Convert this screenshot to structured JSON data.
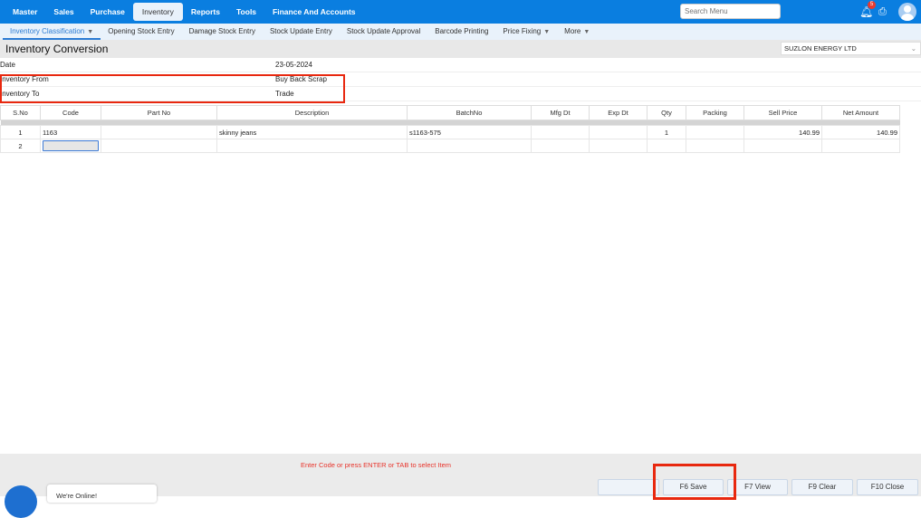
{
  "topnav": {
    "items": [
      "Master",
      "Sales",
      "Purchase",
      "Inventory",
      "Reports",
      "Tools",
      "Finance And Accounts"
    ],
    "active": "Inventory"
  },
  "search": {
    "placeholder": "Search Menu"
  },
  "notifications": {
    "count": "5"
  },
  "subnav": {
    "items": [
      "Inventory Classification",
      "Opening Stock Entry",
      "Damage Stock Entry",
      "Stock Update Entry",
      "Stock Update Approval",
      "Barcode Printing",
      "Price Fixing",
      "More"
    ]
  },
  "page": {
    "title": "Inventory Conversion",
    "company": "SUZLON ENERGY LTD"
  },
  "form": {
    "date_label": "Date",
    "date": "23-05-2024",
    "from_label": "Inventory From",
    "from": "Buy Back Scrap",
    "to_label": "Inventory To",
    "to": "Trade"
  },
  "table": {
    "headers": [
      "S.No",
      "Code",
      "Part No",
      "Description",
      "BatchNo",
      "Mfg Dt",
      "Exp Dt",
      "Qty",
      "Packing",
      "Sell Price",
      "Net Amount"
    ],
    "rows": [
      {
        "sno": "1",
        "code": "1163",
        "part": "",
        "desc": "skinny jeans",
        "batch": "s1163-575",
        "mfg": "",
        "exp": "",
        "qty": "1",
        "packing": "",
        "sell": "140.99",
        "net": "140.99"
      },
      {
        "sno": "2"
      }
    ]
  },
  "footer": {
    "message": "Enter Code or press ENTER or TAB to select Item",
    "buttons": [
      "F6 Save",
      "F7 View",
      "F9 Clear",
      "F10 Close"
    ]
  },
  "chat": {
    "text": "We're Online!"
  },
  "colors": {
    "primary": "#0a7ee0",
    "highlight": "#e8280f"
  }
}
